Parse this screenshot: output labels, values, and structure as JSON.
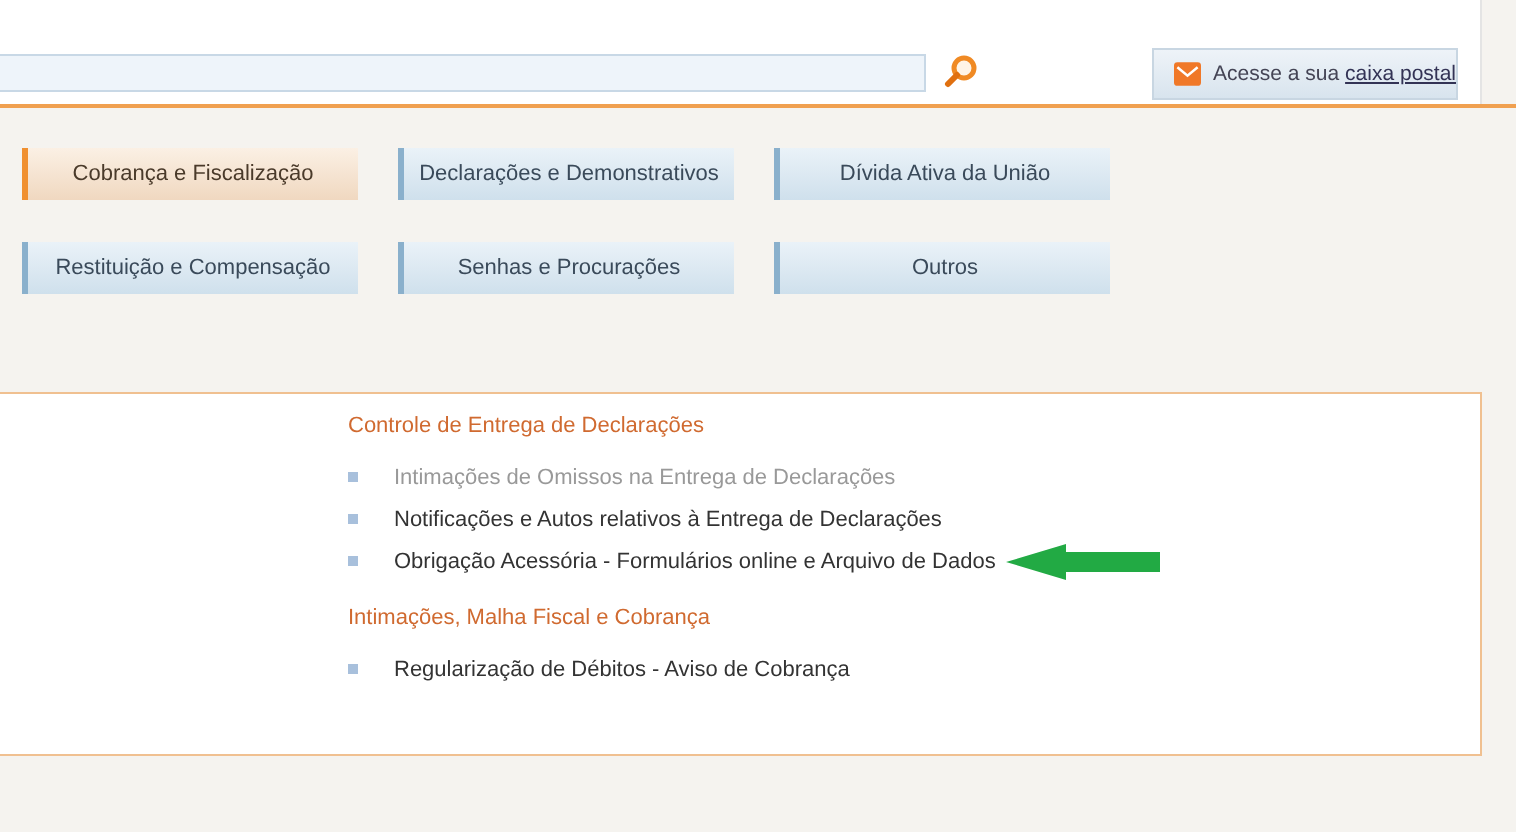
{
  "header": {
    "mail": {
      "text": "Acesse a sua",
      "link": "caixa postal"
    }
  },
  "categories": [
    {
      "label": "Cobrança e Fiscalização",
      "selected": true
    },
    {
      "label": "Declarações e Demonstrativos",
      "selected": false
    },
    {
      "label": "Dívida Ativa da União",
      "selected": false
    },
    {
      "label": "Restituição e Compensação",
      "selected": false
    },
    {
      "label": "Senhas e Procurações",
      "selected": false
    },
    {
      "label": "Outros",
      "selected": false
    }
  ],
  "sections": [
    {
      "title": "Controle de Entrega de Declarações",
      "items": [
        {
          "label": "Intimações de Omissos na Entrega de Declarações",
          "disabled": true,
          "arrow": false
        },
        {
          "label": "Notificações e Autos relativos à Entrega de Declarações",
          "disabled": false,
          "arrow": false
        },
        {
          "label": "Obrigação Acessória - Formulários online e Arquivo de Dados",
          "disabled": false,
          "arrow": true
        }
      ]
    },
    {
      "title": "Intimações, Malha Fiscal e Cobrança",
      "items": [
        {
          "label": "Regularização de Débitos - Aviso de Cobrança",
          "disabled": false,
          "arrow": false
        }
      ]
    }
  ]
}
